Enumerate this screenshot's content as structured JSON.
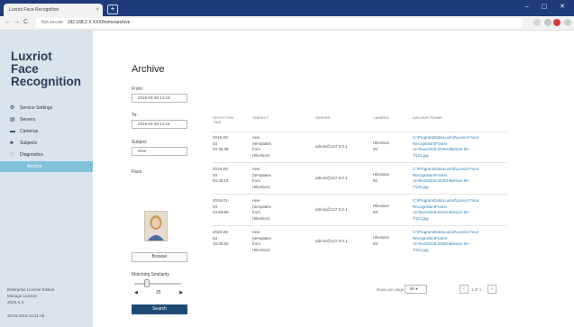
{
  "browser": {
    "tab_title": "Luxriot Face Recognition",
    "tab_close": "×",
    "new_tab": "+",
    "window_controls": "– ▢ ✕",
    "nav_back": "←",
    "nav_forward": "→",
    "nav_reload": "C",
    "security_label": "Not secure",
    "url": "192.168.2.X:XXX/home/archive"
  },
  "sidebar": {
    "brand": [
      "Luxriot",
      "Face",
      "Recognition"
    ],
    "items": [
      {
        "label": "Service Settings",
        "icon": "gear-icon",
        "glyph": "⚙"
      },
      {
        "label": "Servers",
        "icon": "server-icon",
        "glyph": "▤"
      },
      {
        "label": "Cameras",
        "icon": "camera-icon",
        "glyph": "▬"
      },
      {
        "label": "Subjects",
        "icon": "subjects-icon",
        "glyph": "♣"
      },
      {
        "label": "Diagnostics",
        "icon": "diagnostics-icon",
        "glyph": "♡"
      }
    ],
    "active_item": "Archive",
    "license": [
      "Enterprise License Edition",
      "Manage License",
      "2019.X.X"
    ],
    "timestamp": "28.03.2019 14:21:28"
  },
  "main": {
    "title": "Archive",
    "from_label": "From:",
    "from_value": "2019-03-28 14:18",
    "to_label": "To:",
    "to_value": "2019-03-28 14:18",
    "subject_label": "Subject",
    "subject_value": "New",
    "face_label": "Face",
    "browse_label": "Browse",
    "similarity_label": "Matching Similarity",
    "similarity_value": "25",
    "search_label": "Search"
  },
  "table": {
    "columns": [
      "Detection Time",
      "Subject",
      "Server",
      "Camera",
      "Archive Frame"
    ],
    "rows": [
      {
        "time": [
          "2019-20-",
          "03",
          "04:36:08"
        ],
        "subject": [
          "new",
          "(templates",
          "from",
          "Hikvision)"
        ],
        "server": "admin@127.0.0.1",
        "camera": [
          "Hikvision",
          "IM"
        ],
        "frame": [
          "C:\\ProgramData\\Luxriot\\Luxriot Face",
          "Recognition\\Frame",
          "Archive\\2019.0\\20\\Hikvision IM",
          "T121.jpg"
        ]
      },
      {
        "time": [
          "2019-20-",
          "03",
          "04:36:18"
        ],
        "subject": [
          "new",
          "(templates",
          "from",
          "Hikvision)"
        ],
        "server": "admin@127.0.0.1",
        "camera": [
          "Hikvision",
          "IM"
        ],
        "frame": [
          "C:\\ProgramData\\Luxriot\\Luxriot Face",
          "Recognition\\Frame",
          "Archive\\2019.0\\20\\Hikvision IM",
          "T120.jpg"
        ]
      },
      {
        "time": [
          "2019-21-",
          "03",
          "04:59:59"
        ],
        "subject": [
          "new",
          "(templates",
          "from",
          "Hikvision)"
        ],
        "server": "admin@127.0.0.1",
        "camera": [
          "Hikvision",
          "IM"
        ],
        "frame": [
          "C:\\ProgramData\\Luxriot\\Luxriot Face",
          "Recognition\\Frame",
          "Archive\\2019.0\\21\\Hikvision IM",
          "T121.jpg"
        ]
      },
      {
        "time": [
          "2019-26-",
          "03",
          "16:06:59"
        ],
        "subject": [
          "new",
          "(templates",
          "from",
          "Hikvision)"
        ],
        "server": "admin@127.0.0.1",
        "camera": [
          "Hikvision",
          "IM"
        ],
        "frame": [
          "C:\\ProgramData\\Luxriot\\Luxriot Face",
          "Recognition\\Frame",
          "Archive\\2019.0\\26\\Hikvision IM",
          "T161.jpg"
        ]
      }
    ],
    "rows_per_page_label": "Rows per page",
    "rows_per_page_value": "50",
    "page_range": "1 of 1",
    "prev": "‹",
    "next": "›"
  },
  "colors": {
    "sidebar_bg": "#d9e4ec",
    "active_item": "#7fc1d7",
    "primary_button": "#1f4a74",
    "link": "#2a7fb8",
    "browser_bar": "#1f3b7a"
  }
}
